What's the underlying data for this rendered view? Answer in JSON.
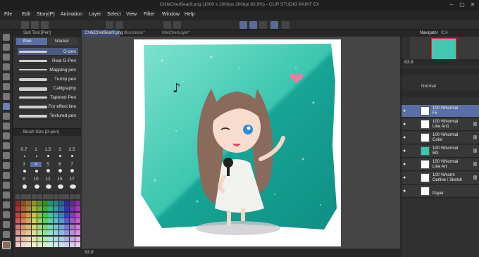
{
  "window": {
    "title": "ChibiCherBear9.png (1000 x 1000px 300dpi 83.9%) - CLIP STUDIO PAINT EX"
  },
  "menu": [
    "File",
    "Edit",
    "Story(P)",
    "Animation",
    "Layer",
    "Select",
    "View",
    "Filter",
    "Window",
    "Help"
  ],
  "subtool": {
    "panel_title": "Sub Tool [Pen]",
    "groups": [
      "Pen",
      "Marker"
    ],
    "brushes": [
      "G-pen",
      "Real G-Pen",
      "Mapping pen",
      "Turnip pen",
      "Calligraphy",
      "Tapered Pen",
      "For effect line",
      "Textured pen"
    ]
  },
  "brush_size": {
    "panel_title": "Brush Size [G-pen]",
    "sizes": [
      "0.7",
      "1",
      "1.5",
      "2",
      "2.5",
      "3",
      "4",
      "5",
      "6",
      "7",
      "8",
      "10",
      "12",
      "15",
      "17"
    ]
  },
  "doc_tabs": [
    "ChibiCherBear9.png",
    "Illustration*",
    "MeiCherLayer*"
  ],
  "status": {
    "zoom": "83.9"
  },
  "navigator": {
    "tabs": [
      "Navigator",
      "ICA"
    ],
    "zoom": "83.9"
  },
  "layer_props": {
    "blend": "Normal"
  },
  "layers": [
    {
      "line1": "100 %Normal",
      "line2": "Fx"
    },
    {
      "line1": "100 %Normal",
      "line2": "Line Art1"
    },
    {
      "line1": "100 %Normal",
      "line2": "Color"
    },
    {
      "line1": "100 %Normal",
      "line2": "BG"
    },
    {
      "line1": "100 %Normal",
      "line2": "Line Art"
    },
    {
      "line1": "100 %Norm",
      "line2": "Outline / Sketch"
    },
    {
      "line1": "",
      "line2": "Paper"
    }
  ],
  "colors": {
    "teal_light": "#7fe3cf",
    "teal_dark": "#17a596",
    "selected_layer": "#5b6fa6",
    "hair": "#8a6a5a"
  }
}
